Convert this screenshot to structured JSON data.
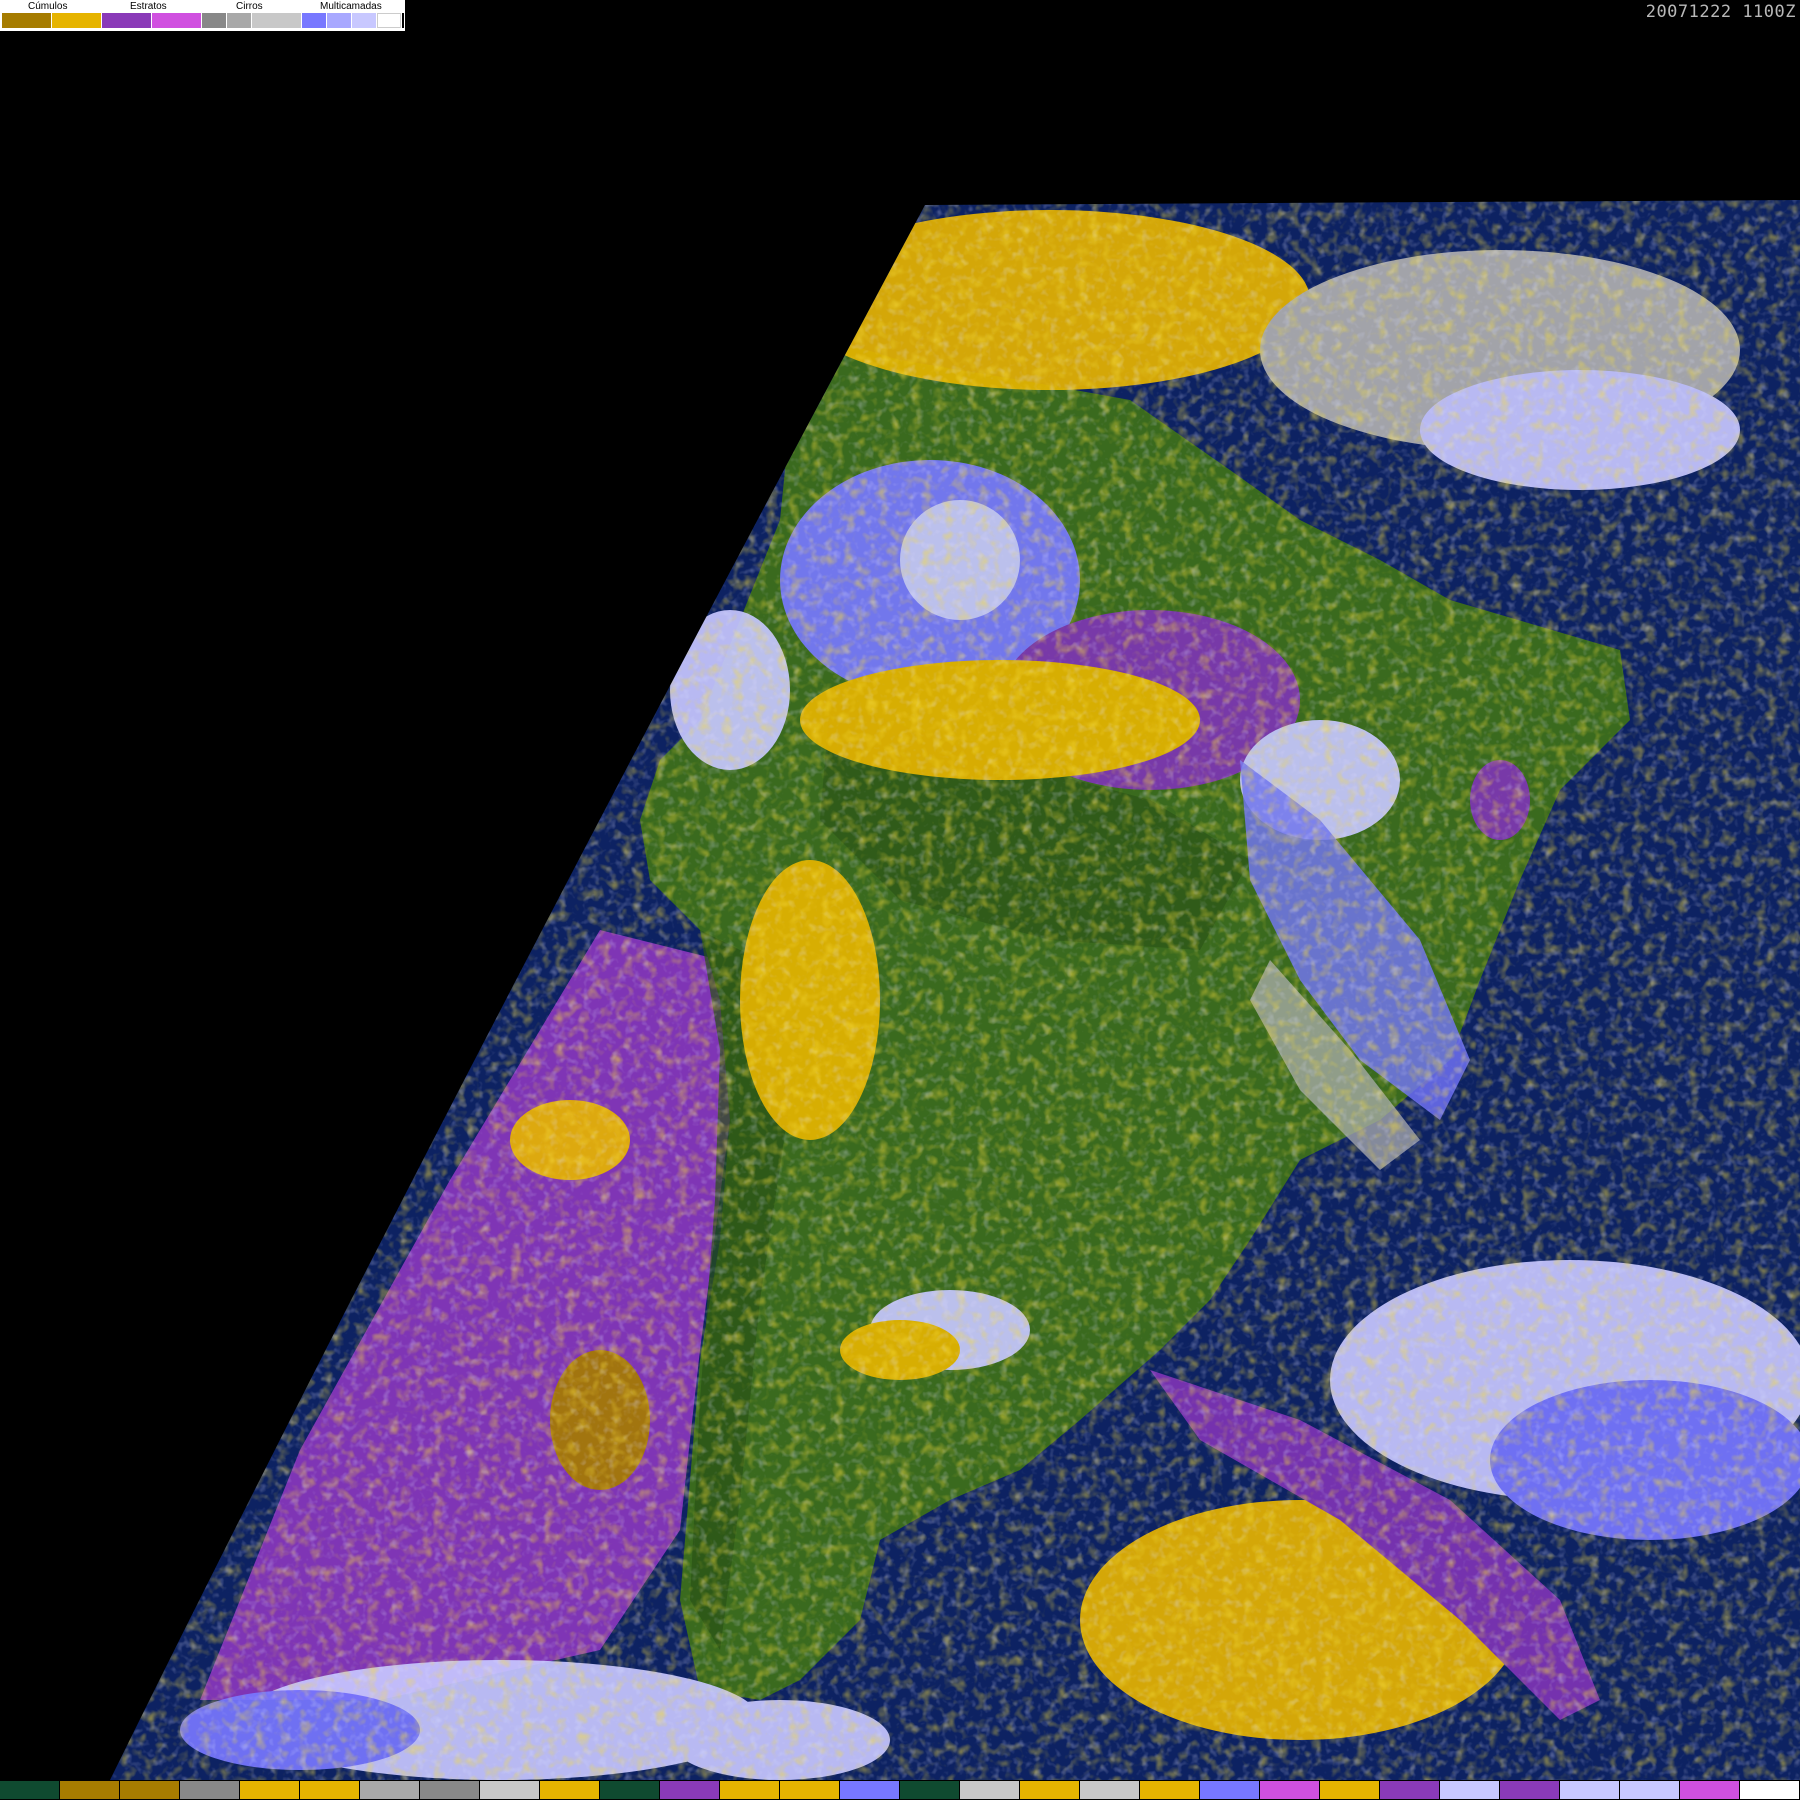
{
  "legend": {
    "groups": [
      {
        "label": "Cúmulos",
        "colors": [
          "#a67c00",
          "#e6b400"
        ]
      },
      {
        "label": "Estratos",
        "colors": [
          "#8a3ab8",
          "#d050e0"
        ]
      },
      {
        "label": "Cirros",
        "colors": [
          "#888888",
          "#a8a8a8",
          "#c8c8c8"
        ]
      },
      {
        "label": "Multicamadas",
        "colors": [
          "#7878ff",
          "#a8a8ff",
          "#c8c8ff",
          "#ffffff"
        ]
      }
    ]
  },
  "timestamp": "20071222  1100Z",
  "colors": {
    "background": "#000000",
    "ocean": "#0d2262",
    "land": "#3a6a1e",
    "land_dark": "#2a5216",
    "cumulus": "#e6b400",
    "cumulus_dark": "#a67c00",
    "stratus": "#7f35b5",
    "stratus_light": "#d050e0",
    "cirrus": "#b0b0b0",
    "multilayer": "#7878ff",
    "multilayer_light": "#c8c8ff"
  },
  "bottom_bar": [
    "#0f4a30",
    "#a67c00",
    "#a67c00",
    "#888888",
    "#e6b400",
    "#e6b400",
    "#a8a8a8",
    "#888888",
    "#c8c8c8",
    "#e6b400",
    "#0f4a30",
    "#8a3ab8",
    "#e6b400",
    "#e6b400",
    "#7878ff",
    "#0f4a30",
    "#c8c8c8",
    "#e6b400",
    "#c8c8c8",
    "#e6b400",
    "#7878ff",
    "#d050e0",
    "#e6b400",
    "#8a3ab8",
    "#c8c8ff",
    "#8a3ab8",
    "#c8c8ff",
    "#c8c8ff",
    "#d050e0",
    "#ffffff"
  ]
}
